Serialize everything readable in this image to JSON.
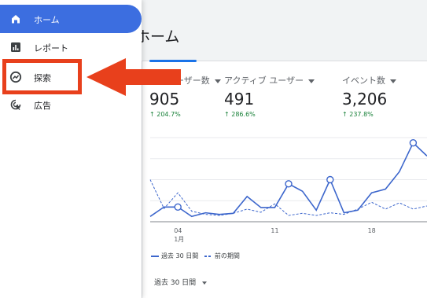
{
  "page": {
    "title": "ホーム"
  },
  "sidebar": {
    "items": [
      {
        "label": "ホーム",
        "icon": "home-icon",
        "active": true
      },
      {
        "label": "レポート",
        "icon": "bar-chart-icon"
      },
      {
        "label": "探索",
        "icon": "explore-icon"
      },
      {
        "label": "広告",
        "icon": "ads-cursor-icon"
      }
    ]
  },
  "metrics": [
    {
      "label": "新規ユーザー数",
      "value": "905",
      "change": "204.7%"
    },
    {
      "label": "アクティブ ユーザー",
      "value": "491",
      "change": "286.6%"
    },
    {
      "label": "イベント数",
      "value": "3,206",
      "change": "237.8%"
    }
  ],
  "chart_data": {
    "type": "line",
    "x_ticks": [
      "04\n1月",
      "11",
      "18"
    ],
    "x_tick_lines": [
      [
        "04",
        "1月"
      ],
      [
        "11"
      ],
      [
        "18"
      ]
    ],
    "series": [
      {
        "name": "過去 30 日間",
        "style": "solid",
        "values": [
          10,
          28,
          28,
          10,
          17,
          14,
          16,
          48,
          27,
          27,
          72,
          58,
          22,
          80,
          17,
          22,
          55,
          62,
          95,
          150,
          125
        ]
      },
      {
        "name": "前の期間",
        "style": "dashed",
        "values": [
          80,
          25,
          55,
          20,
          14,
          12,
          16,
          24,
          18,
          34,
          12,
          16,
          12,
          17,
          14,
          24,
          37,
          24,
          36,
          24,
          30
        ]
      }
    ],
    "markers_on_solid": [
      2,
      10,
      13,
      19
    ]
  },
  "legend": {
    "current": "過去 30 日間",
    "previous": "前の期間"
  },
  "period": {
    "label": "過去 30 日間"
  },
  "colors": {
    "accent": "#3c6ee0",
    "highlight": "#e8401c",
    "positive": "#188038"
  }
}
